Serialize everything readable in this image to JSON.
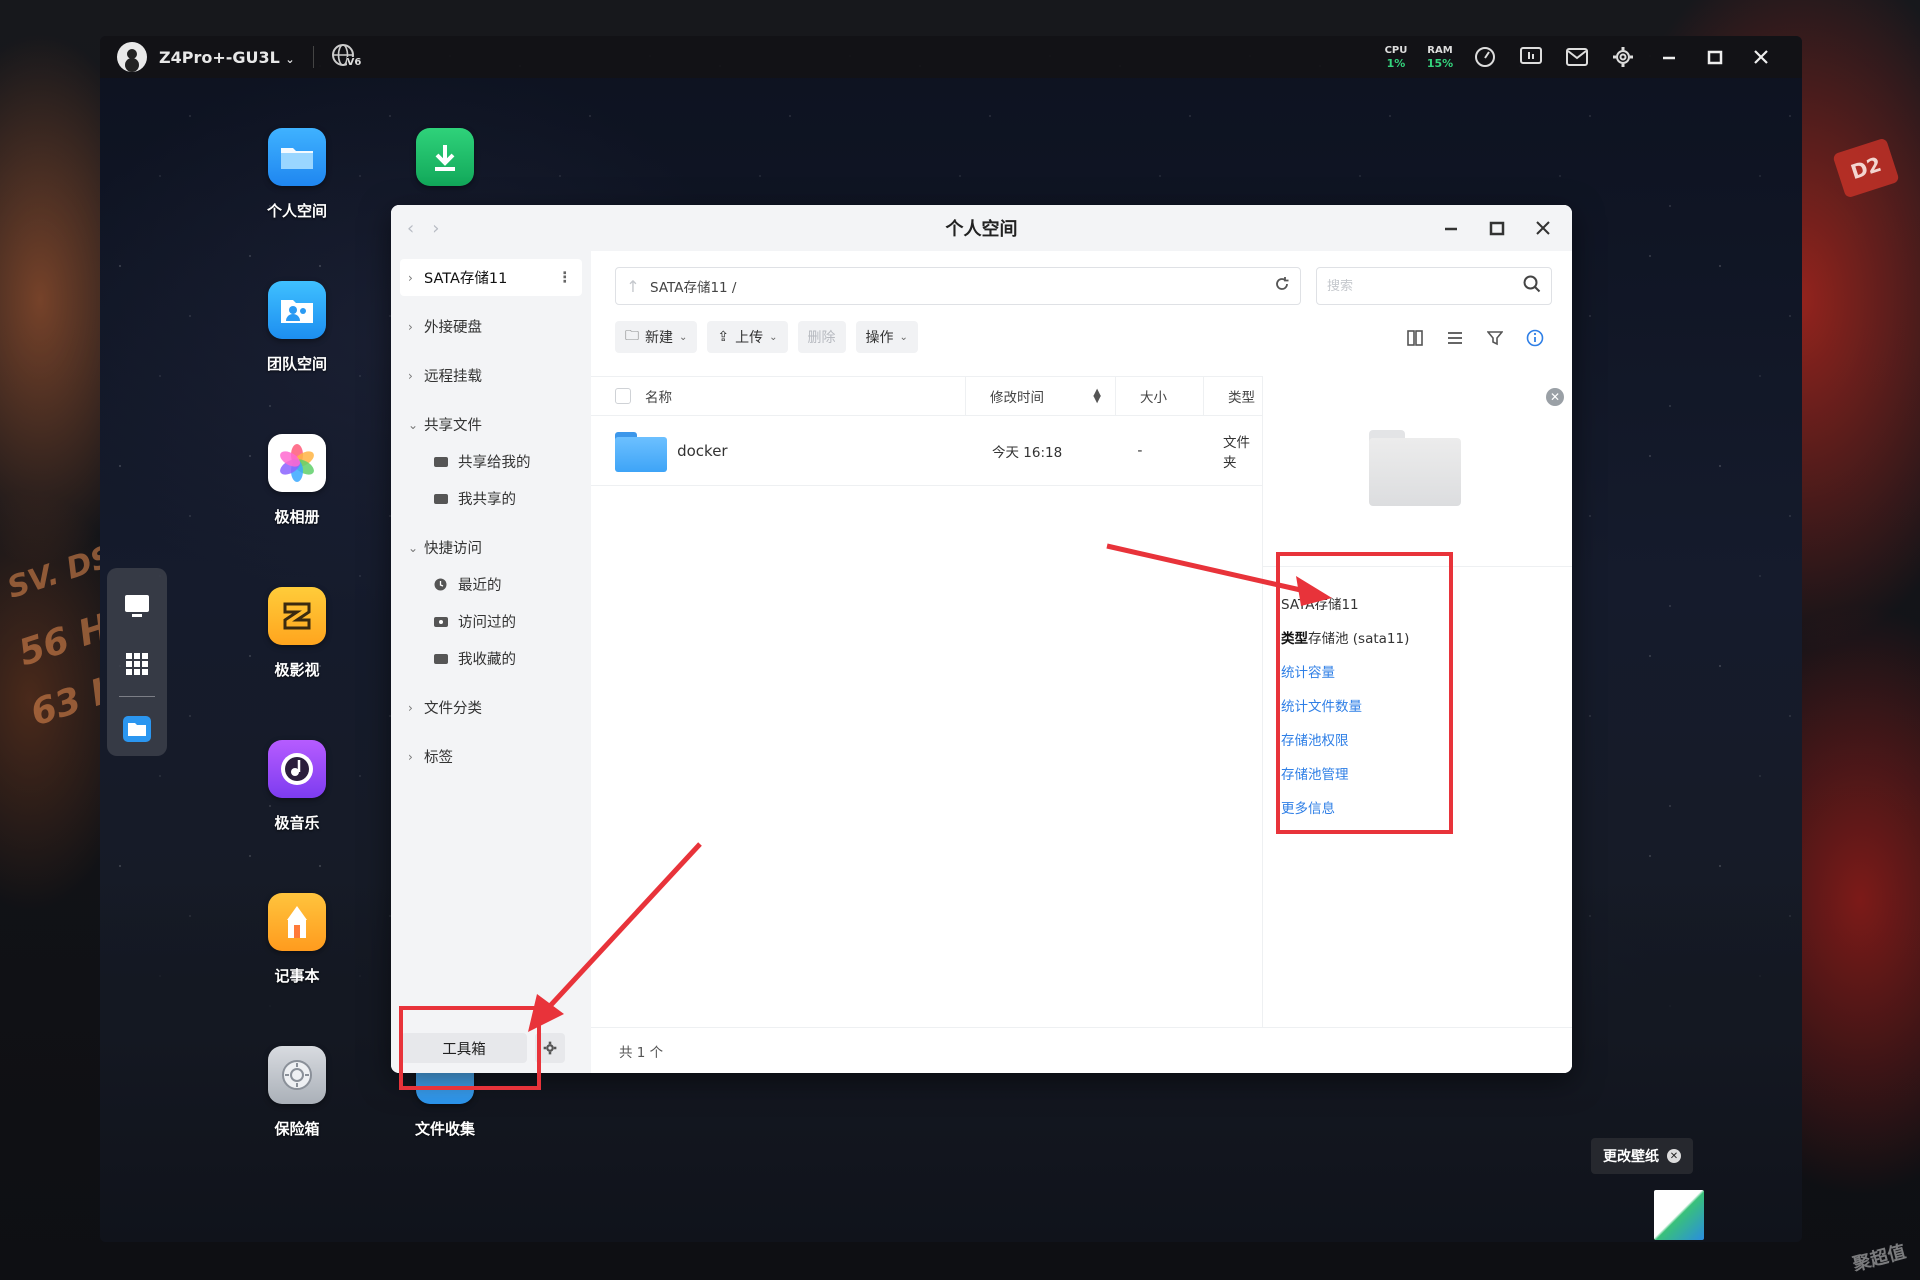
{
  "background": {
    "labels": [
      "SV. DS",
      "56 H",
      "63 H",
      "D2"
    ],
    "watermark": "聚超值"
  },
  "topbar": {
    "device_name": "Z4Pro+-GU3L",
    "network_badge": "V6",
    "cpu_label": "CPU",
    "cpu_value": "1%",
    "ram_label": "RAM",
    "ram_value": "15%",
    "icons": [
      "gauge-icon",
      "monitor-icon",
      "mail-icon",
      "gear-icon",
      "minimize-icon",
      "maximize-icon",
      "close-icon"
    ],
    "accent_green": "#34d27c"
  },
  "desktop": {
    "icons": [
      {
        "label": "个人空间",
        "icon": "folder-app-icon"
      },
      {
        "label": "团队空间",
        "icon": "team-folder-icon"
      },
      {
        "label": "极相册",
        "icon": "photos-icon"
      },
      {
        "label": "极影视",
        "icon": "video-icon"
      },
      {
        "label": "极音乐",
        "icon": "music-icon"
      },
      {
        "label": "记事本",
        "icon": "notebook-icon"
      },
      {
        "label": "保险箱",
        "icon": "safe-icon"
      },
      {
        "label": "",
        "icon": "download-icon"
      },
      {
        "label": "文件收集",
        "icon": "file-collect-icon"
      }
    ]
  },
  "window": {
    "title": "个人空间",
    "sidebar": {
      "storage": "SATA存储11",
      "items": [
        {
          "label": "外接硬盘"
        },
        {
          "label": "远程挂载"
        },
        {
          "label": "共享文件",
          "children": [
            "共享给我的",
            "我共享的"
          ]
        },
        {
          "label": "快捷访问",
          "children": [
            "最近的",
            "访问过的",
            "我收藏的"
          ]
        },
        {
          "label": "文件分类"
        },
        {
          "label": "标签"
        }
      ],
      "toolbox": "工具箱"
    },
    "path": "SATA存储11 /",
    "search_placeholder": "搜索",
    "toolbar": {
      "new": "新建",
      "upload": "上传",
      "delete": "删除",
      "actions": "操作"
    },
    "columns": {
      "name": "名称",
      "modified": "修改时间",
      "size": "大小",
      "type": "类型"
    },
    "files": [
      {
        "name": "docker",
        "modified": "今天 16:18",
        "size": "-",
        "type": "文件夹"
      }
    ],
    "detail": {
      "name": "SATA存储11",
      "type_label": "类型",
      "type_value": "存储池 (sata11)",
      "links": [
        "统计容量",
        "统计文件数量",
        "存储池权限",
        "存储池管理",
        "更多信息"
      ]
    },
    "footer": "共 1 个"
  },
  "wallpaper_button": "更改壁纸",
  "annotation_color": "#e8333a",
  "link_color": "#2f7fe6"
}
